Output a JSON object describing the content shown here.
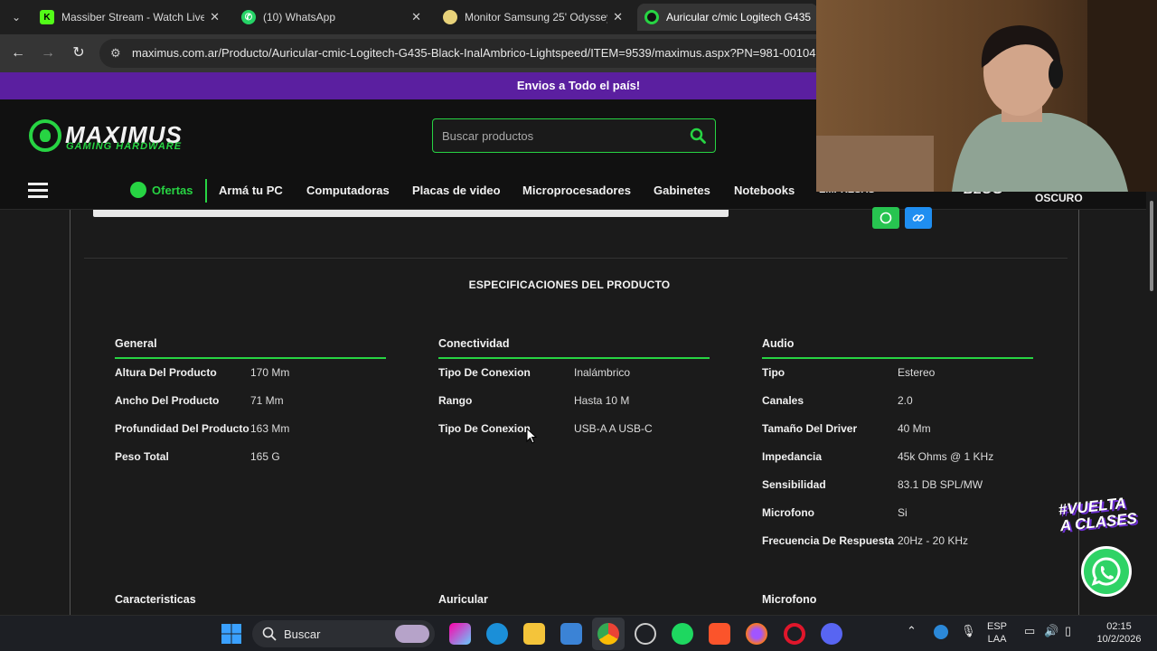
{
  "browser": {
    "tabs": [
      {
        "title": "Massiber Stream - Watch Live on",
        "favicon": "kick-icon",
        "color": "#53fc18"
      },
      {
        "title": "(10) WhatsApp",
        "favicon": "whatsapp-icon",
        "color": "#25d366"
      },
      {
        "title": "Monitor Samsung 25' Odyssey",
        "favicon": "store-icon",
        "color": "#e8d27a"
      },
      {
        "title": "Auricular c/mic Logitech G435",
        "favicon": "maximus-icon",
        "color": "#27d443",
        "active": true
      }
    ],
    "url": "maximus.com.ar/Producto/Auricular-cmic-Logitech-G435-Black-InalAmbrico-Lightspeed/ITEM=9539/maximus.aspx?PN=981-00104"
  },
  "site": {
    "promo": "Envios a Todo el país!",
    "logo": {
      "main": "MAXIMUS",
      "sub": "GAMING HARDWARE"
    },
    "search_placeholder": "Buscar productos",
    "accent": "#27d443",
    "nav": [
      "Ofertas",
      "Armá tu PC",
      "Computadoras",
      "Placas de video",
      "Microprocesadores",
      "Gabinetes",
      "Notebooks",
      "EMPRESAS",
      "BLOG",
      "OSCURO"
    ]
  },
  "specs": {
    "title": "ESPECIFICACIONES DEL PRODUCTO",
    "columns": [
      {
        "heading": "General",
        "rows": [
          {
            "k": "Altura Del Producto",
            "v": "170 Mm"
          },
          {
            "k": "Ancho Del Producto",
            "v": "71 Mm"
          },
          {
            "k": "Profundidad Del Producto",
            "v": "163 Mm"
          },
          {
            "k": "Peso Total",
            "v": "165 G"
          }
        ]
      },
      {
        "heading": "Conectividad",
        "rows": [
          {
            "k": "Tipo De Conexion",
            "v": "Inalámbrico"
          },
          {
            "k": "Rango",
            "v": "Hasta 10 M"
          },
          {
            "k": "Tipo De Conexion",
            "v": "USB-A A USB-C"
          }
        ]
      },
      {
        "heading": "Audio",
        "rows": [
          {
            "k": "Tipo",
            "v": "Estereo"
          },
          {
            "k": "Canales",
            "v": "2.0"
          },
          {
            "k": "Tamaño Del Driver",
            "v": "40 Mm"
          },
          {
            "k": "Impedancia",
            "v": "45k Ohms @ 1 KHz"
          },
          {
            "k": "Sensibilidad",
            "v": "83.1 DB SPL/MW"
          },
          {
            "k": "Microfono",
            "v": "Si"
          },
          {
            "k": "Frecuencia De Respuesta",
            "v": "20Hz - 20 KHz"
          }
        ]
      }
    ],
    "next_sections": [
      "Caracteristicas",
      "Auricular",
      "Microfono"
    ]
  },
  "promo_badge": [
    "#VUELTA",
    "A CLASES"
  ],
  "taskbar": {
    "search_label": "Buscar",
    "lang": [
      "ESP",
      "LAA"
    ],
    "time": "02:15",
    "date": "10/2/2026"
  }
}
